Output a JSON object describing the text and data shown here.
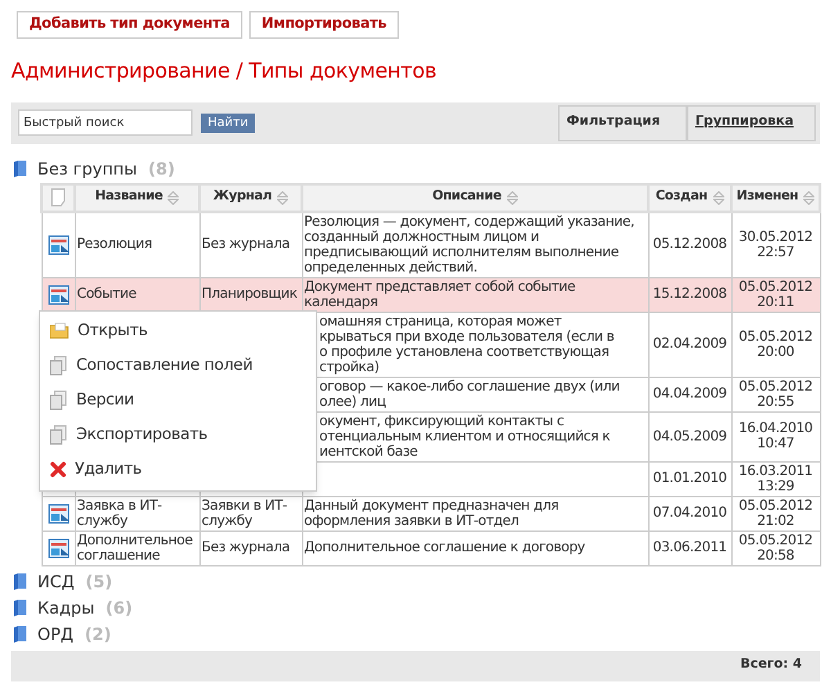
{
  "toolbar_buttons": [
    "Добавить тип документа",
    "Импортировать"
  ],
  "page_title": "Администрирование / Типы документов",
  "search": {
    "placeholder": "Быстрый поиск",
    "button": "Найти"
  },
  "view_tabs": [
    {
      "label": "Фильтрация",
      "kind": "text"
    },
    {
      "label": "Группировка",
      "kind": "link"
    }
  ],
  "groups": [
    {
      "name": "Без группы",
      "count": "(8)",
      "table": {
        "columns": [
          "Название",
          "Журнал",
          "Описание",
          "Создан",
          "Изменен"
        ],
        "rows": [
          {
            "name": "Резолюция",
            "journal": "Без журнала",
            "description": "Резолюция — документ, содержащий указание, созданный должностным лицом и предписывающий исполнителям выполнение определенных действий.",
            "created": "05.12.2008",
            "modified": "30.05.2012 22:57",
            "selected": false
          },
          {
            "name": "Событие",
            "journal": "Планировщик",
            "description": "Документ представляет собой событие календаря",
            "created": "15.12.2008",
            "modified": "05.05.2012 20:11",
            "selected": true
          },
          {
            "description": "омашняя страница, которая может\nкрываться при входе пользователя (если в\nо профиле установлена соответствующая\nстройка)",
            "created": "02.04.2009",
            "modified": "05.05.2012 20:00",
            "selected": false
          },
          {
            "description": "оговор — какое-либо соглашение двух (или\nолее) лиц",
            "created": "04.04.2009",
            "modified": "05.05.2012 20:55",
            "selected": false
          },
          {
            "description": "окумент, фиксирующий контакты с\nотенциальным клиентом и относящийся к\nиентской базе",
            "created": "04.05.2009",
            "modified": "16.04.2010 10:47",
            "selected": false
          },
          {
            "created": "01.01.2010",
            "modified": "16.03.2011 13:29",
            "selected": false
          },
          {
            "name": "Заявка в ИТ-службу",
            "journal": "Заявки в ИТ-службу",
            "description": "Данный документ предназначен для оформления заявки в ИТ-отдел",
            "created": "07.04.2010",
            "modified": "05.05.2012 21:02",
            "selected": false
          },
          {
            "name": "Дополнительное соглашение",
            "journal": "Без журнала",
            "description": "Дополнительное соглашение к договору",
            "created": "03.06.2011",
            "modified": "05.05.2012 20:58",
            "selected": false
          }
        ]
      },
      "context_menu": [
        {
          "label": "Открыть",
          "kind": "folder"
        },
        {
          "label": "Сопоставление полей",
          "kind": "copy"
        },
        {
          "label": "Версии",
          "kind": "copy"
        },
        {
          "label": "Экспортировать",
          "kind": "copy"
        },
        {
          "label": "Удалить",
          "kind": "delete"
        }
      ]
    },
    {
      "name": "ИСД",
      "count": "(5)"
    },
    {
      "name": "Кадры",
      "count": "(6)"
    },
    {
      "name": "ОРД",
      "count": "(2)"
    }
  ],
  "footer": "Всего: 4"
}
